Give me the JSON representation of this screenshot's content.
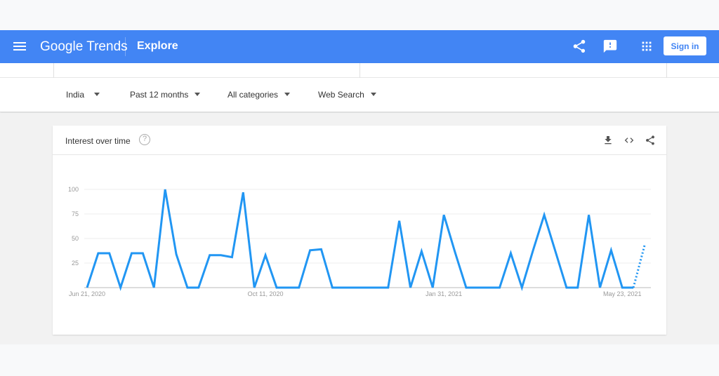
{
  "header": {
    "logo": "Google Trends",
    "section": "Explore",
    "signin_label": "Sign in",
    "icons": [
      "menu-icon",
      "share-icon",
      "feedback-icon",
      "apps-icon"
    ],
    "color": "#4285f4"
  },
  "filters": [
    {
      "label": "India"
    },
    {
      "label": "Past 12 months"
    },
    {
      "label": "All categories"
    },
    {
      "label": "Web Search"
    }
  ],
  "card": {
    "title": "Interest over time",
    "help": "?",
    "icons": [
      "download-icon",
      "embed-icon",
      "share-icon"
    ]
  },
  "chart_data": {
    "type": "line",
    "title": "Interest over time",
    "ylim": [
      0,
      100
    ],
    "yticks": [
      "25",
      "50",
      "75",
      "100"
    ],
    "xtick_labels": [
      {
        "index": 0,
        "label": "Jun 21, 2020"
      },
      {
        "index": 16,
        "label": "Oct 11, 2020"
      },
      {
        "index": 32,
        "label": "Jan 31, 2021"
      },
      {
        "index": 48,
        "label": "May 23, 2021"
      }
    ],
    "x_start": "Jun 21, 2020",
    "x_interval": "weekly",
    "values": [
      0,
      35,
      35,
      0,
      35,
      35,
      0,
      100,
      34,
      0,
      0,
      33,
      33,
      31,
      97,
      0,
      33,
      0,
      0,
      0,
      38,
      39,
      0,
      0,
      0,
      0,
      0,
      0,
      68,
      0,
      37,
      0,
      74,
      36,
      0,
      0,
      0,
      0,
      35,
      0,
      38,
      74,
      37,
      0,
      0,
      74,
      0,
      38,
      0,
      0,
      43
    ],
    "partial_last_point": true,
    "line_color": "#2196f3",
    "grid": true
  }
}
